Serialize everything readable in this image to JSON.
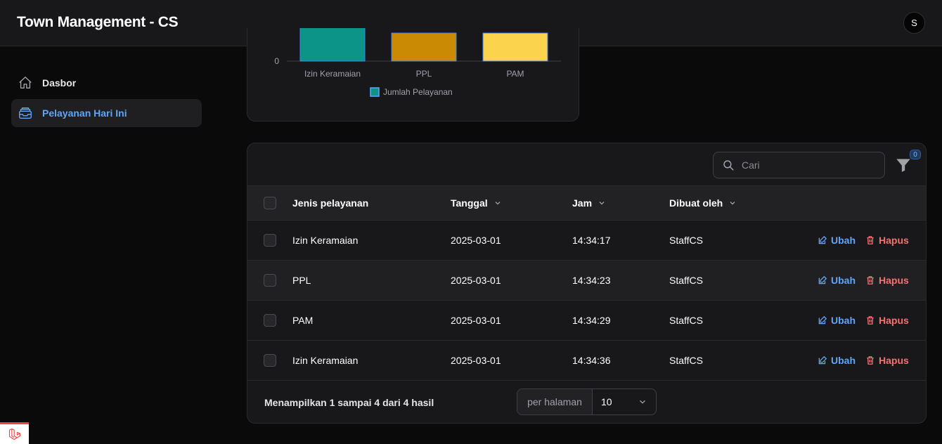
{
  "app": {
    "title": "Town Management - CS",
    "avatar_initial": "S"
  },
  "sidebar": {
    "items": [
      {
        "label": "Dasbor",
        "icon": "home-icon",
        "active": false
      },
      {
        "label": "Pelayanan Hari Ini",
        "icon": "inbox-stack-icon",
        "active": true
      }
    ]
  },
  "chart_data": {
    "type": "bar",
    "categories": [
      "Izin Keramaian",
      "PPL",
      "PAM"
    ],
    "series": [
      {
        "name": "Jumlah Pelayanan",
        "values": [
          2,
          1,
          1
        ],
        "colors": [
          "#0d9488",
          "#ca8a04",
          "#fcd34d"
        ]
      }
    ],
    "y_tick_visible": "0",
    "legend_position": "bottom"
  },
  "table": {
    "search_placeholder": "Cari",
    "filter_count": "0",
    "columns": [
      "Jenis pelayanan",
      "Tanggal",
      "Jam",
      "Dibuat oleh"
    ],
    "rows": [
      {
        "jenis": "Izin Keramaian",
        "tanggal": "2025-03-01",
        "jam": "14:34:17",
        "oleh": "StaffCS"
      },
      {
        "jenis": "PPL",
        "tanggal": "2025-03-01",
        "jam": "14:34:23",
        "oleh": "StaffCS"
      },
      {
        "jenis": "PAM",
        "tanggal": "2025-03-01",
        "jam": "14:34:29",
        "oleh": "StaffCS"
      },
      {
        "jenis": "Izin Keramaian",
        "tanggal": "2025-03-01",
        "jam": "14:34:36",
        "oleh": "StaffCS"
      }
    ],
    "edit_label": "Ubah",
    "delete_label": "Hapus",
    "summary": "Menampilkan 1 sampai 4 dari 4 hasil",
    "per_page_label": "per halaman",
    "per_page_value": "10"
  },
  "colors": {
    "accent": "#60a5fa",
    "danger": "#f87171",
    "background": "#0a0a0b",
    "card": "#18181b"
  }
}
